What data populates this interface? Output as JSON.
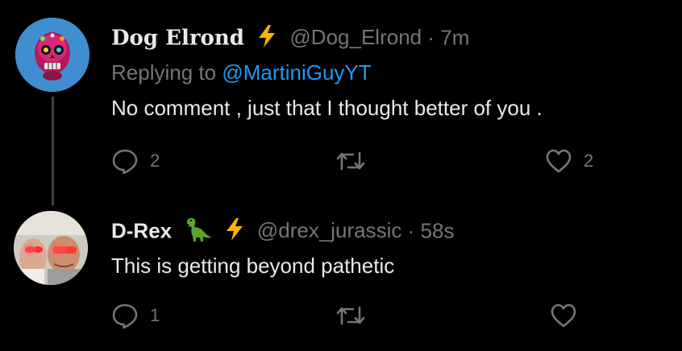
{
  "tweets": [
    {
      "display_name": "Dog Elrond",
      "handle": "@Dog_Elrond",
      "separator": "·",
      "time": "7m",
      "replying_prefix": "Replying to",
      "replying_to": "@MartiniGuyYT",
      "text": "No comment , just that I thought better of you .",
      "reply_count": "2",
      "retweet_count": "",
      "like_count": "2"
    },
    {
      "display_name": "D-Rex",
      "handle": "@drex_jurassic",
      "separator": "·",
      "time": "58s",
      "text": "This is getting beyond pathetic",
      "reply_count": "1",
      "retweet_count": "",
      "like_count": ""
    }
  ],
  "colors": {
    "background": "#000000",
    "text": "#e7e9ea",
    "muted": "#71767b",
    "link": "#1d9bf0",
    "lightning": "#f7b500",
    "dino": "#5aa532"
  },
  "icons": [
    "lightning-icon",
    "dinosaur-icon",
    "reply-icon",
    "retweet-icon",
    "like-icon"
  ]
}
